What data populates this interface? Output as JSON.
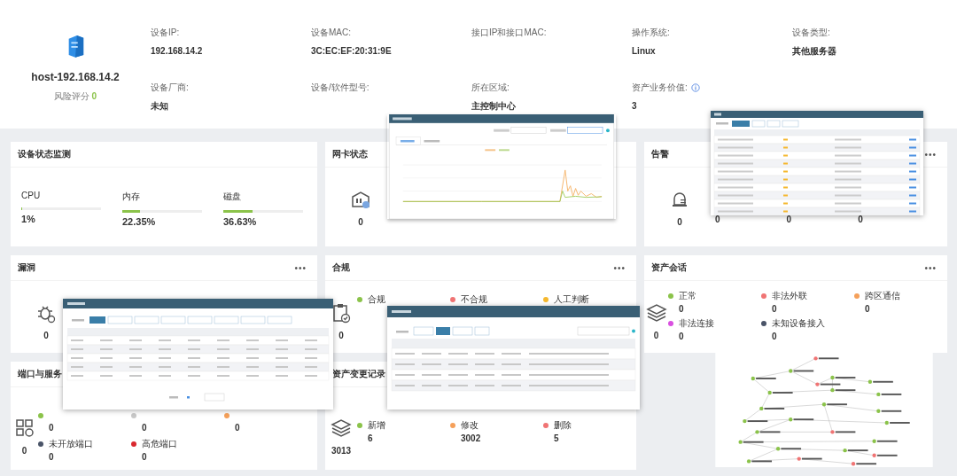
{
  "host": {
    "name": "host-192.168.14.2",
    "risk_label": "风险评分",
    "risk_score": "0"
  },
  "fields": [
    {
      "label": "设备IP:",
      "value": "192.168.14.2"
    },
    {
      "label": "设备MAC:",
      "value": "3C:EC:EF:20:31:9E"
    },
    {
      "label": "接口IP和接口MAC:"
    },
    {
      "label": "操作系统:",
      "value": "Linux"
    },
    {
      "label": "设备类型:",
      "value": "其他服务器"
    },
    {
      "label": "设备厂商:",
      "value": "未知"
    },
    {
      "label": "设备/软件型号:"
    },
    {
      "label": "所在区域:",
      "value": "主控制中心"
    },
    {
      "label": "资产业务价值:",
      "value": "3",
      "info": true
    }
  ],
  "device_status": {
    "title": "设备状态监测",
    "metrics": [
      {
        "label": "CPU",
        "value": "1%",
        "level": 0.01
      },
      {
        "label": "内存",
        "value": "22.35%",
        "level": 0.2235
      },
      {
        "label": "磁盘",
        "value": "36.63%",
        "level": 0.3663
      }
    ]
  },
  "nic": {
    "title": "网卡状态",
    "count": "0"
  },
  "alarm": {
    "title": "告警",
    "count": "0",
    "more": "•••",
    "counts": [
      "0",
      "0",
      "0"
    ]
  },
  "vuln": {
    "title": "漏洞",
    "count": "0",
    "more": "•••"
  },
  "compliance": {
    "title": "合规",
    "count": "0",
    "more": "•••",
    "legend": [
      {
        "label": "合规",
        "color": "#8bc34a"
      },
      {
        "label": "不合规",
        "color": "#f07474"
      },
      {
        "label": "人工判断",
        "color": "#f5b82e"
      }
    ]
  },
  "session": {
    "title": "资产会话",
    "count": "0",
    "more": "•••",
    "stats": [
      {
        "label": "正常",
        "value": "0",
        "color": "#8bc34a"
      },
      {
        "label": "非法外联",
        "value": "0",
        "color": "#f07474"
      },
      {
        "label": "跨区通信",
        "value": "0",
        "color": "#f5a05a"
      },
      {
        "label": "非法连接",
        "value": "0",
        "color": "#d94fe0"
      },
      {
        "label": "未知设备接入",
        "value": "0",
        "color": "#4a5468"
      }
    ]
  },
  "ports": {
    "title": "端口与服务",
    "count": "0",
    "top_stats": [
      {
        "value": "0",
        "color": "#8bc34a"
      },
      {
        "value": "0",
        "color": "#c8c8c8"
      },
      {
        "value": "0",
        "color": "#f5a05a"
      }
    ],
    "stats": [
      {
        "label": "未开放端口",
        "value": "0",
        "color": "#4a5468"
      },
      {
        "label": "高危端口",
        "value": "0",
        "color": "#d9282f"
      }
    ]
  },
  "changes": {
    "title": "资产变更记录",
    "count": "3013",
    "stats": [
      {
        "label": "新增",
        "value": "6",
        "color": "#8bc34a"
      },
      {
        "label": "修改",
        "value": "3002",
        "color": "#f5a05a"
      },
      {
        "label": "删除",
        "value": "5",
        "color": "#f07474"
      }
    ]
  }
}
